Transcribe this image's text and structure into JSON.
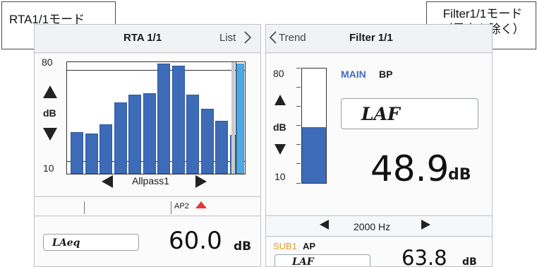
{
  "captions": {
    "left": "RTA1/1モード",
    "right_line1": "Filter1/1モード",
    "right_line2": "（異音を除く）"
  },
  "rta": {
    "title": "RTA 1/1",
    "list_label": "List",
    "y_top": "80",
    "y_bottom": "10",
    "db_unit": "dB",
    "filter_label": "Allpass1",
    "marker_label": "AP2",
    "bars": [
      32,
      31,
      38,
      55,
      61,
      62,
      85,
      83,
      61,
      50,
      41,
      30
    ],
    "extra_bar": 85,
    "lbox": "LAeq",
    "value": "60.0",
    "value_unit": "dB"
  },
  "filter": {
    "trend_label": "Trend",
    "title": "Filter 1/1",
    "y_top": "80",
    "y_bottom": "10",
    "db_unit": "dB",
    "main_label": "MAIN",
    "mode_label": "BP",
    "lbox": "LAF",
    "value": "48.9",
    "value_unit": "dB",
    "level": 0.49,
    "freq_label": "2000 Hz",
    "sub_label": "SUB1",
    "sub_mode": "AP",
    "sub_lbox": "LAF",
    "sub_value": "63.8",
    "sub_unit": "dB"
  },
  "colors": {
    "bar": "#3d6bb8",
    "extra_bar": "#4da8e6",
    "main_accent": "#3f6dc4",
    "sub_accent": "#e49a29",
    "marker": "#e33838"
  }
}
